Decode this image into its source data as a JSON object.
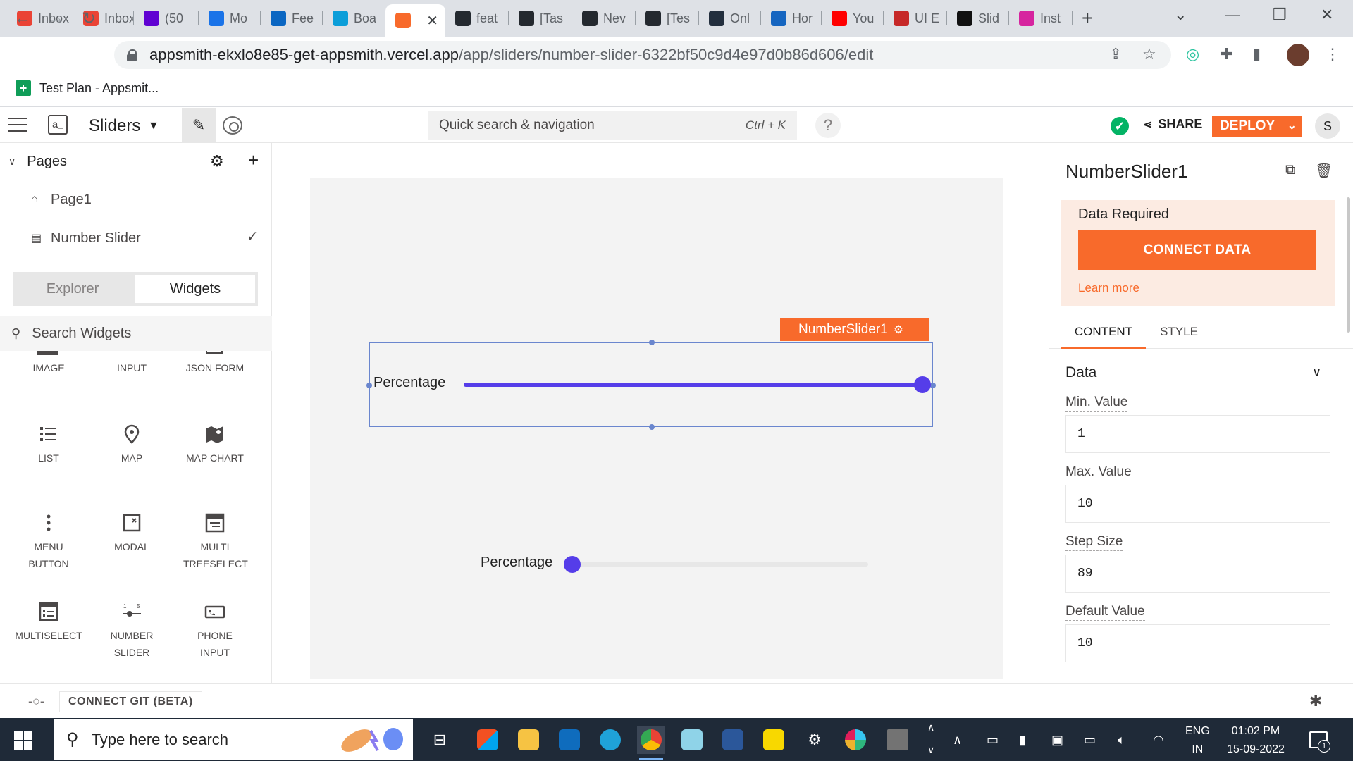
{
  "browser": {
    "tabs": [
      {
        "title": "Inbox",
        "favicon": "gmail-icon",
        "color": "#ea4335"
      },
      {
        "title": "Inbox",
        "favicon": "gmail-icon",
        "color": "#ea4335"
      },
      {
        "title": "(50",
        "favicon": "yahoo-mail-icon",
        "color": "#6001d2"
      },
      {
        "title": "Mo",
        "favicon": "calendar-icon",
        "color": "#1a73e8"
      },
      {
        "title": "Fee",
        "favicon": "linkedin-icon",
        "color": "#0a66c2"
      },
      {
        "title": "Boa",
        "favicon": "board-icon",
        "color": "#0b9ed9"
      },
      {
        "title": "",
        "favicon": "appsmith-icon",
        "color": "#f86a2b"
      },
      {
        "title": "feat",
        "favicon": "github-icon",
        "color": "#24292f"
      },
      {
        "title": "[Tas",
        "favicon": "github-icon",
        "color": "#24292f"
      },
      {
        "title": "Nev",
        "favicon": "github-icon",
        "color": "#24292f"
      },
      {
        "title": "[Tes",
        "favicon": "github-icon",
        "color": "#24292f"
      },
      {
        "title": "Onl",
        "favicon": "amazon-icon",
        "color": "#232f3e"
      },
      {
        "title": "Hor",
        "favicon": "k-icon",
        "color": "#1565c0"
      },
      {
        "title": "You",
        "favicon": "youtube-icon",
        "color": "#ff0000"
      },
      {
        "title": "UI E",
        "favicon": "ui-icon",
        "color": "#c62828"
      },
      {
        "title": "Slid",
        "favicon": "notion-icon",
        "color": "#111111"
      },
      {
        "title": "Inst",
        "favicon": "instagram-icon",
        "color": "#d6249f"
      }
    ],
    "url_host": "appsmith-ekxlo8e85-get-appsmith.vercel.app",
    "url_path": "/app/sliders/number-slider-6322bf50c9d4e97d0b86d606/edit",
    "bookmark": "Test Plan - Appsmit..."
  },
  "header": {
    "app_logo": "a_",
    "app_name": "Sliders",
    "search_placeholder": "Quick search & navigation",
    "search_shortcut": "Ctrl + K",
    "help": "?",
    "share_label": "SHARE",
    "deploy_label": "DEPLOY",
    "user_initial": "S"
  },
  "sidebar": {
    "pages_title": "Pages",
    "pages": [
      {
        "label": "Page1",
        "icon": "home-icon"
      },
      {
        "label": "Number Slider",
        "icon": "page-icon"
      }
    ],
    "tabs": {
      "explorer": "Explorer",
      "widgets": "Widgets"
    },
    "search_placeholder": "Search Widgets",
    "widgets_partial": [
      "IMAGE",
      "INPUT",
      "JSON FORM"
    ],
    "widgets": [
      {
        "label": "LIST",
        "icon": "list-icon"
      },
      {
        "label": "MAP",
        "icon": "map-pin-icon"
      },
      {
        "label": "MAP CHART",
        "icon": "map-chart-icon"
      },
      {
        "label": "MENU BUTTON",
        "icon": "menu-button-icon"
      },
      {
        "label": "MODAL",
        "icon": "modal-icon"
      },
      {
        "label": "MULTI TREESELECT",
        "icon": "multi-treeselect-icon"
      },
      {
        "label": "MULTISELECT",
        "icon": "multiselect-icon"
      },
      {
        "label": "NUMBER SLIDER",
        "icon": "number-slider-icon"
      },
      {
        "label": "PHONE INPUT",
        "icon": "phone-input-icon"
      }
    ]
  },
  "bottom": {
    "connect_git": "CONNECT GIT (BETA)"
  },
  "canvas": {
    "widget_name": "NumberSlider1",
    "slider1": {
      "label": "Percentage",
      "value_fraction": 1.0
    },
    "slider2": {
      "label": "Percentage",
      "value_fraction": 0.0
    },
    "colors": {
      "accent": "#553de9",
      "selection": "#6a86ce",
      "brand": "#f86a2b"
    }
  },
  "property_pane": {
    "title": "NumberSlider1",
    "data_required": "Data Required",
    "connect_data": "CONNECT DATA",
    "learn_more": "Learn more",
    "tabs": [
      "CONTENT",
      "STYLE"
    ],
    "section": "Data",
    "props": [
      {
        "label": "Min. Value",
        "value": "1"
      },
      {
        "label": "Max. Value",
        "value": "10"
      },
      {
        "label": "Step Size",
        "value": "89"
      },
      {
        "label": "Default Value",
        "value": "10"
      }
    ]
  },
  "taskbar": {
    "search_placeholder": "Type here to search",
    "lang_top": "ENG",
    "lang_bottom": "IN",
    "time": "01:02 PM",
    "date": "15-09-2022",
    "notifications": "1"
  }
}
